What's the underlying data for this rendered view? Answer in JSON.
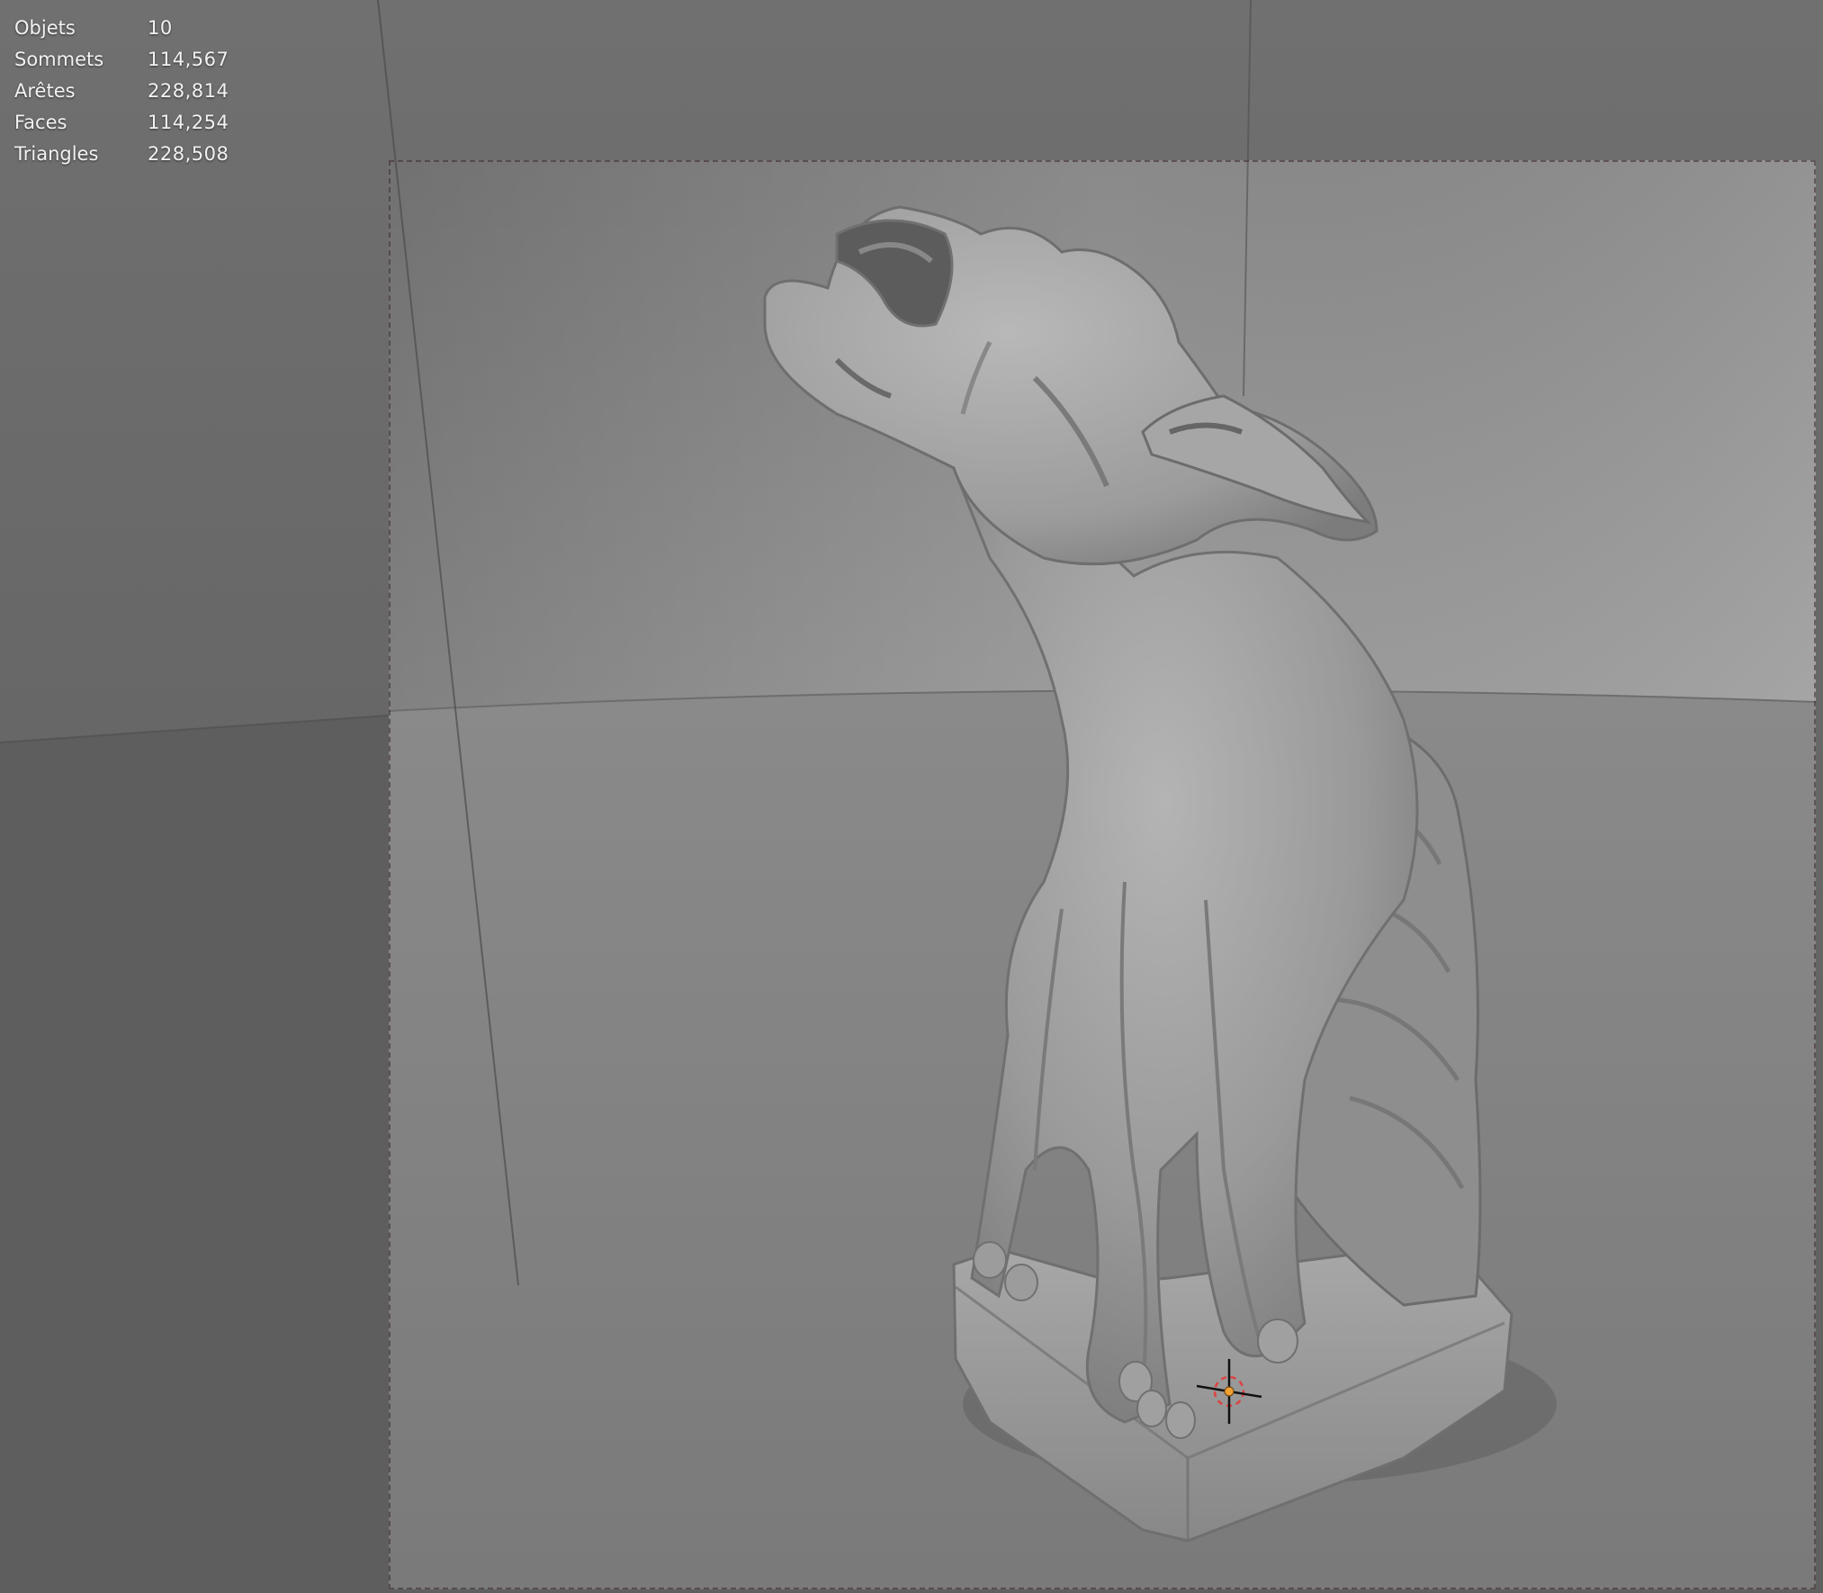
{
  "app": {
    "name": "3D viewport"
  },
  "stats": [
    {
      "label": "Objets",
      "value": "10"
    },
    {
      "label": "Sommets",
      "value": "114,567"
    },
    {
      "label": "Arêtes",
      "value": "228,814"
    },
    {
      "label": "Faces",
      "value": "114,254"
    },
    {
      "label": "Triangles",
      "value": "228,508"
    }
  ],
  "colors": {
    "background_dark": "#5e5e5e",
    "backdrop_light": "#b8b8b8",
    "floor": "#7e7e7e",
    "model": "#9a9a9a",
    "cursor_accent": "#f0a030",
    "cursor_ring": "#e04040"
  },
  "icons": {
    "cursor": "3d-cursor-icon"
  }
}
